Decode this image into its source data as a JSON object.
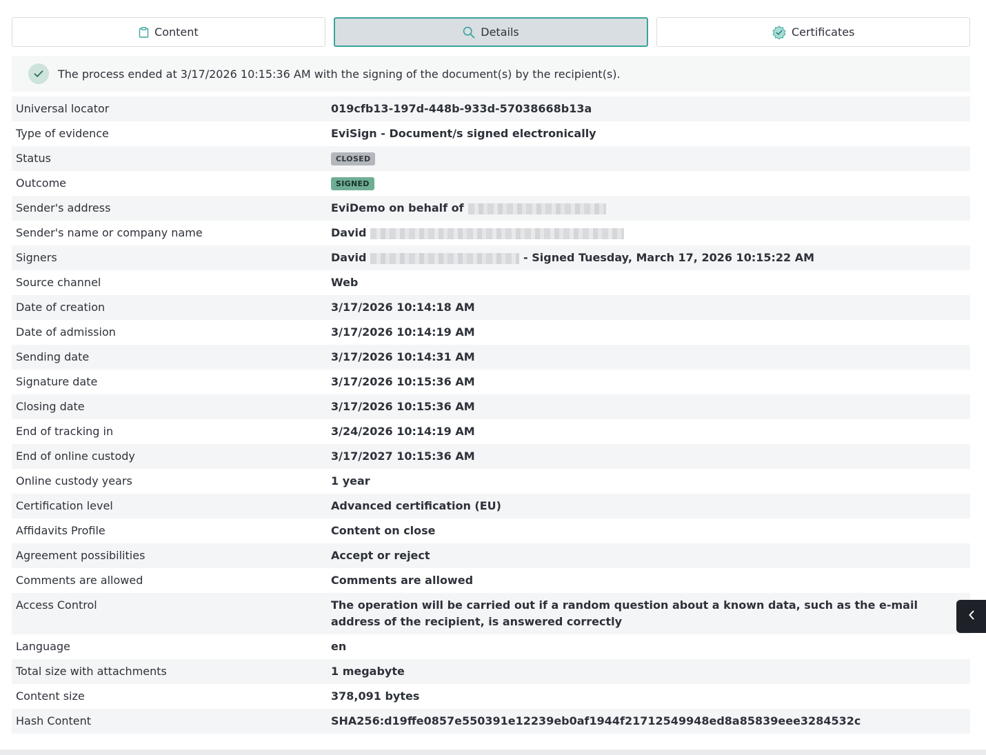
{
  "tabs": [
    {
      "label": "Content",
      "icon": "clipboard-icon",
      "active": false
    },
    {
      "label": "Details",
      "icon": "search-icon",
      "active": true
    },
    {
      "label": "Certificates",
      "icon": "certificate-badge-icon",
      "active": false
    }
  ],
  "banner": {
    "icon": "check-icon",
    "text": "The process ended at 3/17/2026 10:15:36 AM with the signing of the document(s) by the recipient(s)."
  },
  "details": {
    "universal_locator": {
      "label": "Universal locator",
      "value": "019cfb13-197d-448b-933d-57038668b13a"
    },
    "type_of_evidence": {
      "label": "Type of evidence",
      "value": "EviSign - Document/s signed electronically"
    },
    "status": {
      "label": "Status",
      "value": "CLOSED"
    },
    "outcome": {
      "label": "Outcome",
      "value": "SIGNED"
    },
    "sender_address": {
      "label": "Sender's address",
      "value": "EviDemo on behalf of"
    },
    "sender_name": {
      "label": "Sender's name or company name",
      "value": "David"
    },
    "signers": {
      "label": "Signers",
      "value": "David",
      "suffix": "- Signed Tuesday, March 17, 2026 10:15:22 AM"
    },
    "source_channel": {
      "label": "Source channel",
      "value": "Web"
    },
    "date_of_creation": {
      "label": "Date of creation",
      "value": "3/17/2026 10:14:18 AM"
    },
    "date_of_admission": {
      "label": "Date of admission",
      "value": "3/17/2026 10:14:19 AM"
    },
    "sending_date": {
      "label": "Sending date",
      "value": "3/17/2026 10:14:31 AM"
    },
    "signature_date": {
      "label": "Signature date",
      "value": "3/17/2026 10:15:36 AM"
    },
    "closing_date": {
      "label": "Closing date",
      "value": "3/17/2026 10:15:36 AM"
    },
    "end_of_tracking": {
      "label": "End of tracking in",
      "value": "3/24/2026 10:14:19 AM"
    },
    "end_of_custody": {
      "label": "End of online custody",
      "value": "3/17/2027 10:15:36 AM"
    },
    "custody_years": {
      "label": "Online custody years",
      "value": "1 year"
    },
    "certification_level": {
      "label": "Certification level",
      "value": "Advanced certification (EU)"
    },
    "affidavits_profile": {
      "label": "Affidavits Profile",
      "value": "Content on close"
    },
    "agreement_possibilities": {
      "label": "Agreement possibilities",
      "value": "Accept or reject"
    },
    "comments_allowed": {
      "label": "Comments are allowed",
      "value": "Comments are allowed"
    },
    "access_control": {
      "label": "Access Control",
      "value": "The operation will be carried out if a random question about a known data, such as the e-mail address of the recipient, is answered correctly"
    },
    "language": {
      "label": "Language",
      "value": "en"
    },
    "total_size": {
      "label": "Total size with attachments",
      "value": "1 megabyte"
    },
    "content_size": {
      "label": "Content size",
      "value": "378,091 bytes"
    },
    "hash_content": {
      "label": "Hash Content",
      "value": "SHA256:d19ffe0857e550391e12239eb0af1944f21712549948ed8a85839eee3284532c"
    }
  },
  "side_toggle": {
    "icon": "chevron-left-icon"
  },
  "colors": {
    "accent": "#3aa39c",
    "closed_badge": "#b3b7bc",
    "signed_badge": "#6fae95",
    "check_circle": "#cfe3dd"
  }
}
